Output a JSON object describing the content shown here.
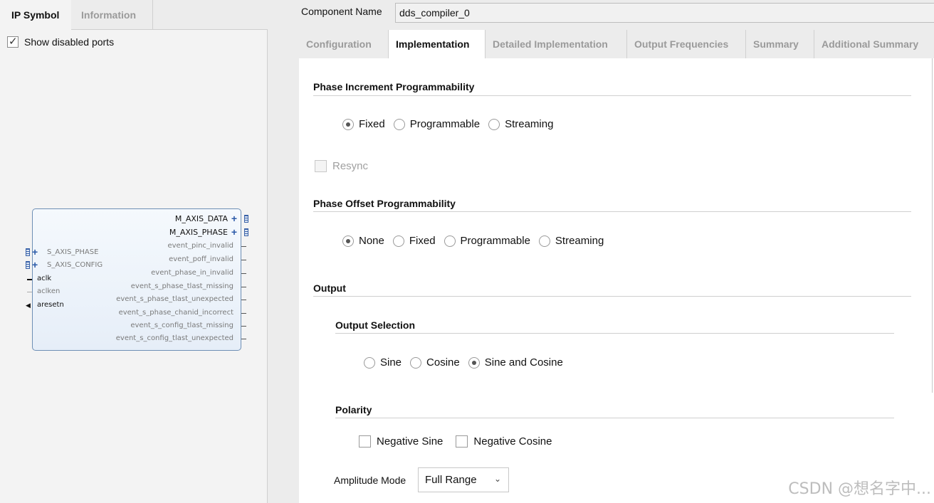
{
  "left": {
    "tabs": [
      "IP Symbol",
      "Information"
    ],
    "show_disabled_label": "Show disabled ports",
    "symbol": {
      "right_ports": [
        {
          "name": "M_AXIS_DATA",
          "kind": "bus"
        },
        {
          "name": "M_AXIS_PHASE",
          "kind": "bus"
        },
        {
          "name": "event_pinc_invalid",
          "kind": "disabled"
        },
        {
          "name": "event_poff_invalid",
          "kind": "disabled"
        },
        {
          "name": "event_phase_in_invalid",
          "kind": "disabled"
        },
        {
          "name": "event_s_phase_tlast_missing",
          "kind": "disabled"
        },
        {
          "name": "event_s_phase_tlast_unexpected",
          "kind": "disabled"
        },
        {
          "name": "event_s_phase_chanid_incorrect",
          "kind": "disabled"
        },
        {
          "name": "event_s_config_tlast_missing",
          "kind": "disabled"
        },
        {
          "name": "event_s_config_tlast_unexpected",
          "kind": "disabled"
        }
      ],
      "left_ports": [
        {
          "name": "S_AXIS_PHASE",
          "kind": "bus-disabled"
        },
        {
          "name": "S_AXIS_CONFIG",
          "kind": "bus-disabled"
        },
        {
          "name": "aclk",
          "kind": "enabled"
        },
        {
          "name": "aclken",
          "kind": "disabled"
        },
        {
          "name": "aresetn",
          "kind": "enabled-inverted"
        }
      ]
    }
  },
  "right": {
    "component_name_label": "Component Name",
    "component_name_value": "dds_compiler_0",
    "tabs": [
      "Configuration",
      "Implementation",
      "Detailed Implementation",
      "Output Frequencies",
      "Summary",
      "Additional Summary"
    ],
    "active_tab": "Implementation",
    "phase_increment": {
      "title": "Phase Increment Programmability",
      "options": [
        "Fixed",
        "Programmable",
        "Streaming"
      ],
      "selected": "Fixed"
    },
    "resync_label": "Resync",
    "phase_offset": {
      "title": "Phase Offset Programmability",
      "options": [
        "None",
        "Fixed",
        "Programmable",
        "Streaming"
      ],
      "selected": "None"
    },
    "output_title": "Output",
    "output_selection": {
      "title": "Output Selection",
      "options": [
        "Sine",
        "Cosine",
        "Sine and Cosine"
      ],
      "selected": "Sine and Cosine"
    },
    "polarity": {
      "title": "Polarity",
      "negative_sine": "Negative Sine",
      "negative_cosine": "Negative Cosine"
    },
    "amplitude_mode": {
      "label": "Amplitude Mode",
      "value": "Full Range"
    }
  },
  "watermark": "CSDN @想名字中...",
  "icons": [
    "check-icon",
    "chevron-down-icon",
    "plus-icon",
    "bus-icon"
  ]
}
